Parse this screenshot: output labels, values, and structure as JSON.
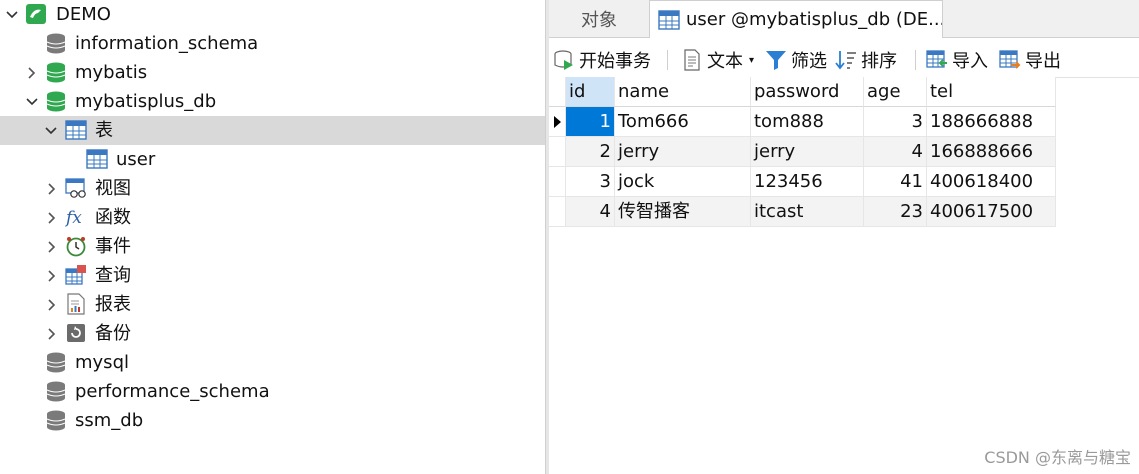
{
  "tree": {
    "connection": "DEMO",
    "databases": [
      {
        "label": "information_schema"
      },
      {
        "label": "mybatis"
      },
      {
        "label": "mybatisplus_db"
      }
    ],
    "open_db_children": {
      "tables": "表",
      "table_user": "user",
      "views": "视图",
      "functions": "函数",
      "events": "事件",
      "queries": "查询",
      "reports": "报表",
      "backups": "备份"
    },
    "other_databases": [
      "mysql",
      "performance_schema",
      "ssm_db"
    ]
  },
  "tabs": {
    "objects": "对象",
    "user_tab": "user @mybatisplus_db (DE..."
  },
  "toolbar": {
    "begin_transaction": "开始事务",
    "text": "文本",
    "filter": "筛选",
    "sort": "排序",
    "import": "导入",
    "export": "导出"
  },
  "grid": {
    "columns": [
      "id",
      "name",
      "password",
      "age",
      "tel"
    ],
    "rows": [
      {
        "id": "1",
        "name": "Tom666",
        "password": "tom888",
        "age": "3",
        "tel": "188666888"
      },
      {
        "id": "2",
        "name": "jerry",
        "password": "jerry",
        "age": "4",
        "tel": "166888666"
      },
      {
        "id": "3",
        "name": "jock",
        "password": "123456",
        "age": "41",
        "tel": "400618400"
      },
      {
        "id": "4",
        "name": "传智播客",
        "password": "itcast",
        "age": "23",
        "tel": "400617500"
      }
    ]
  },
  "watermark": "CSDN @东离与糖宝",
  "colors": {
    "selected_tree_row": "#d9d9d9",
    "selected_cell": "#0078d7",
    "db_icon_green": "#2fa84f",
    "db_icon_gray": "#7a7a7a"
  }
}
